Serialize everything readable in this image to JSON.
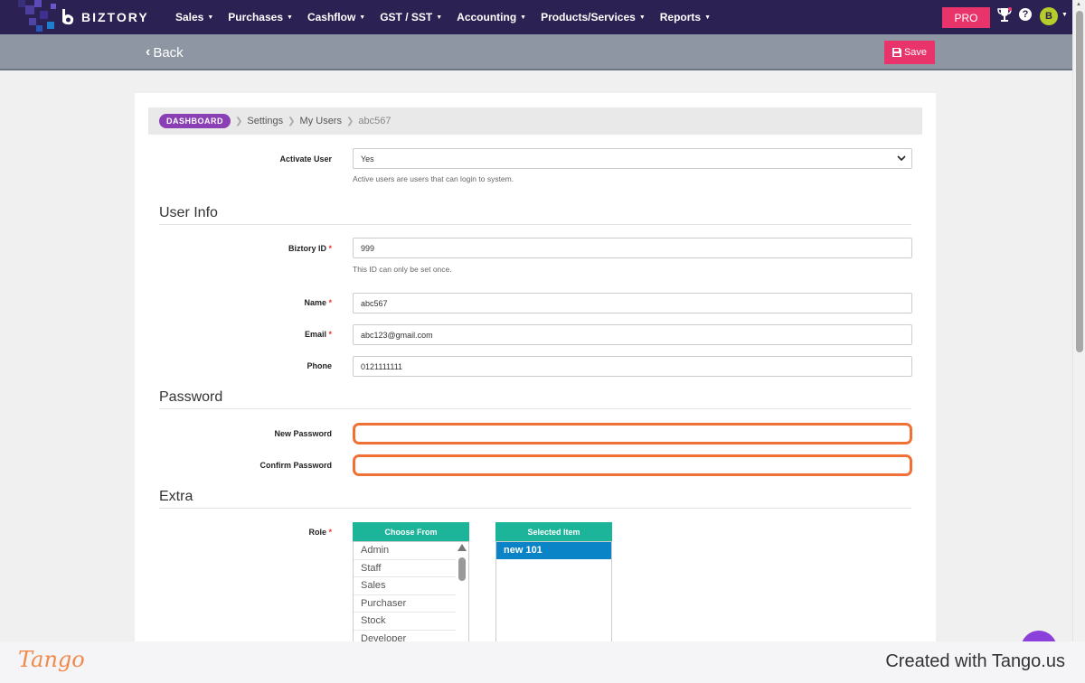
{
  "app": {
    "brand": "BIZTORY",
    "colors": {
      "nav_bg": "#2b2152",
      "accent": "#e8336b",
      "list_header": "#1cb59a",
      "selected": "#0a84c6",
      "highlight": "#f07035"
    }
  },
  "nav": {
    "items": [
      {
        "label": "Sales"
      },
      {
        "label": "Purchases"
      },
      {
        "label": "Cashflow"
      },
      {
        "label": "GST / SST"
      },
      {
        "label": "Accounting"
      },
      {
        "label": "Products/Services"
      },
      {
        "label": "Reports"
      }
    ],
    "pro_label": "PRO",
    "help_label": "?",
    "avatar_initial": "B"
  },
  "toolbar": {
    "back_label": "Back",
    "save_label": "Save"
  },
  "breadcrumb": {
    "dashboard": "DASHBOARD",
    "settings": "Settings",
    "users": "My Users",
    "current": "abc567"
  },
  "form": {
    "activate": {
      "label": "Activate User",
      "value": "Yes",
      "help": "Active users are users that can login to system."
    },
    "user_info_title": "User Info",
    "biztory_id": {
      "label": "Biztory ID",
      "value": "999",
      "help": "This ID can only be set once."
    },
    "name": {
      "label": "Name",
      "value": "abc567"
    },
    "email": {
      "label": "Email",
      "value": "abc123@gmail.com"
    },
    "phone": {
      "label": "Phone",
      "value": "0121111111"
    },
    "password_title": "Password",
    "new_password": {
      "label": "New Password",
      "value": ""
    },
    "confirm_password": {
      "label": "Confirm Password",
      "value": ""
    },
    "extra_title": "Extra",
    "role": {
      "label": "Role",
      "choose_header": "Choose From",
      "selected_header": "Selected Item",
      "options": [
        "Admin",
        "Staff",
        "Sales",
        "Purchaser",
        "Stock",
        "Developer"
      ],
      "selected": [
        "new 101"
      ]
    },
    "required_mark": "*"
  },
  "footer": {
    "tango": "Tango",
    "created": "Created with Tango.us"
  }
}
